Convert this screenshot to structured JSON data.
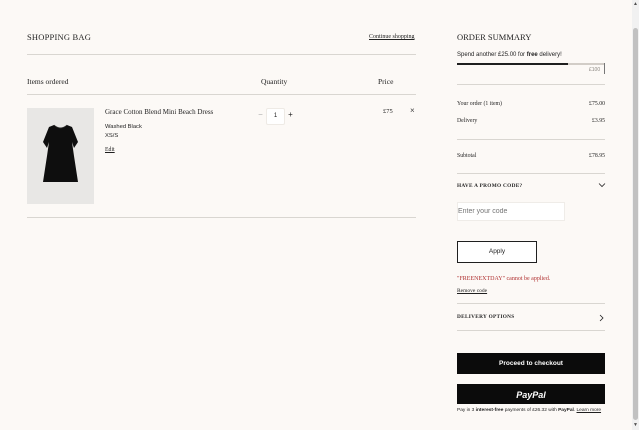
{
  "bag": {
    "title": "SHOPPING BAG",
    "continue_label": "Continue shopping",
    "col_items": "Items ordered",
    "col_quantity": "Quantity",
    "col_price": "Price"
  },
  "item": {
    "name": "Grace Cotton Blend Mini Beach Dress",
    "color": "Washed Black",
    "size": "XS/S",
    "edit_label": "Edit",
    "quantity": "1",
    "price": "£75",
    "minus": "−",
    "plus": "+",
    "remove": "×"
  },
  "summary": {
    "title": "ORDER SUMMARY",
    "spend_prefix": "Spend another £25.00 for ",
    "spend_bold": "free",
    "spend_suffix": " delivery!",
    "threshold_label": "£100",
    "progress_fraction": 0.75,
    "order_label": "Your order (1 item)",
    "order_value": "£75.00",
    "delivery_label": "Delivery",
    "delivery_value": "£3.95",
    "subtotal_label": "Subtotal",
    "subtotal_value": "£78.95"
  },
  "promo": {
    "heading": "HAVE A PROMO CODE?",
    "placeholder": "Enter your code",
    "apply_label": "Apply",
    "error": "\"FREENEXTDAY\" cannot be applied.",
    "remove_label": "Remove code"
  },
  "delivery_options": {
    "label": "DELIVERY OPTIONS"
  },
  "checkout": {
    "label": "Proceed to checkout"
  },
  "paypal": {
    "button": "PayPal",
    "note_prefix": "Pay in 3 ",
    "note_bold": "interest-free",
    "note_mid": " payments of £26.32 with ",
    "note_brand": "PayPal",
    "note_link": "Learn more"
  },
  "colors": {
    "background": "#fcf9f6",
    "text": "#1f1f1f",
    "error": "#b03030",
    "button_dark": "#0b0b0b"
  }
}
